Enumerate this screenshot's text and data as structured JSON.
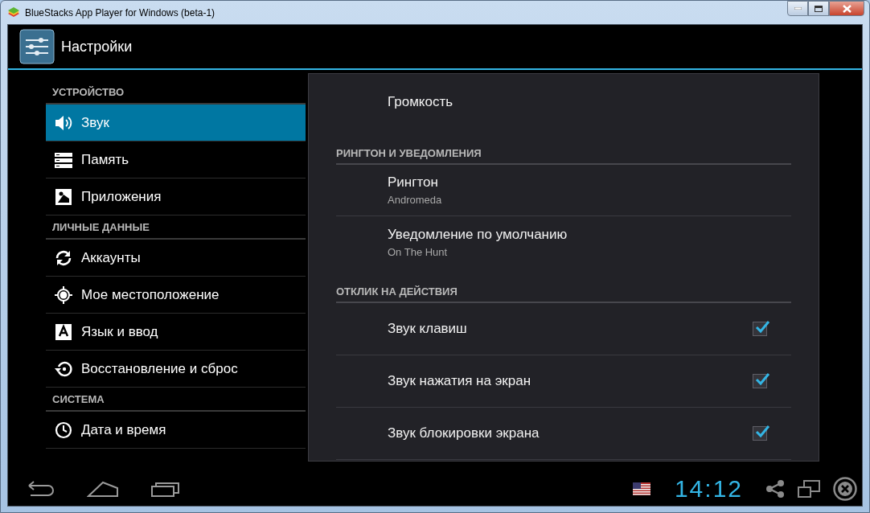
{
  "window": {
    "title": "BlueStacks App Player for Windows (beta-1)"
  },
  "action_bar": {
    "title": "Настройки"
  },
  "sidebar": {
    "sections": [
      {
        "header": "УСТРОЙСТВО",
        "items": [
          {
            "label": "Звук",
            "selected": true
          },
          {
            "label": "Память",
            "selected": false
          },
          {
            "label": "Приложения",
            "selected": false
          }
        ]
      },
      {
        "header": "ЛИЧНЫЕ ДАННЫЕ",
        "items": [
          {
            "label": "Аккаунты",
            "selected": false
          },
          {
            "label": "Мое местоположение",
            "selected": false
          },
          {
            "label": "Язык и ввод",
            "selected": false
          },
          {
            "label": "Восстановление и сброс",
            "selected": false
          }
        ]
      },
      {
        "header": "СИСТЕМА",
        "items": [
          {
            "label": "Дата и время",
            "selected": false
          }
        ]
      }
    ]
  },
  "detail": {
    "items": [
      {
        "kind": "item",
        "title": "Громкость"
      },
      {
        "kind": "header",
        "title": "РИНГТОН И УВЕДОМЛЕНИЯ"
      },
      {
        "kind": "item",
        "title": "Рингтон",
        "summary": "Andromeda"
      },
      {
        "kind": "item",
        "title": "Уведомление по умолчанию",
        "summary": "On The Hunt"
      },
      {
        "kind": "header",
        "title": "ОТКЛИК НА ДЕЙСТВИЯ"
      },
      {
        "kind": "checkbox",
        "title": "Звук клавиш",
        "checked": true
      },
      {
        "kind": "checkbox",
        "title": "Звук нажатия на экран",
        "checked": true
      },
      {
        "kind": "checkbox",
        "title": "Звук блокировки экрана",
        "checked": true
      }
    ]
  },
  "status_bar": {
    "time": "14:12"
  }
}
